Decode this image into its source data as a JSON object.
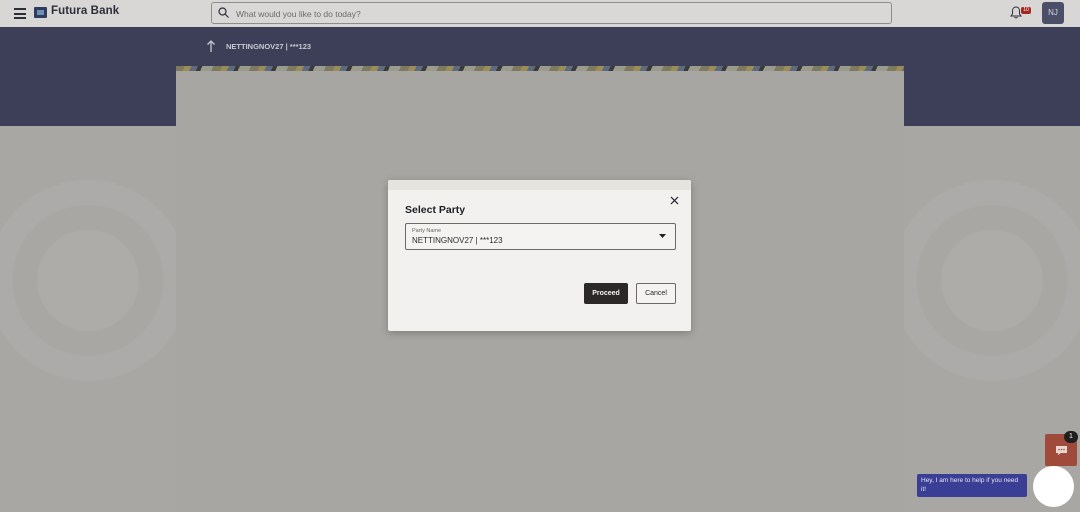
{
  "header": {
    "brand": "Futura Bank",
    "search_placeholder": "What would you like to do today?",
    "notification_count": "10",
    "user_initials": "NJ"
  },
  "page": {
    "account_label": "NETTINGNOV27 | ***123"
  },
  "modal": {
    "title": "Select Party",
    "party_field_label": "Party Name",
    "party_value": "NETTINGNOV27 | ***123",
    "proceed_label": "Proceed",
    "cancel_label": "Cancel"
  },
  "chat": {
    "badge_count": "1",
    "message": "Hey, I am here to help if you need it!"
  },
  "colors": {
    "header_band": "#3c3f57",
    "chat_bubble": "#3a3f95",
    "proceed_button": "#2b2827",
    "notification_badge": "#a3291e"
  }
}
